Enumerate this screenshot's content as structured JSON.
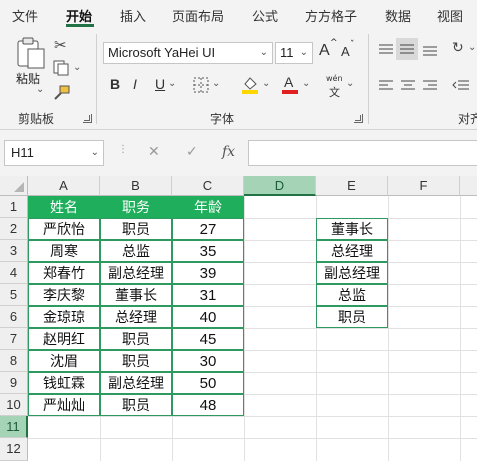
{
  "tabs": [
    "文件",
    "开始",
    "插入",
    "页面布局",
    "公式",
    "方方格子",
    "数据",
    "视图"
  ],
  "active_tab": "开始",
  "ribbon": {
    "clipboard": {
      "paste_label": "粘贴",
      "group_label": "剪贴板"
    },
    "font": {
      "font_name": "Microsoft YaHei UI",
      "font_size": "11",
      "bold": "B",
      "italic": "I",
      "underline": "U",
      "grow": "A",
      "shrink": "A",
      "wen": "wén",
      "wen_char": "文",
      "group_label": "字体",
      "fill_color": "#ffd700",
      "font_color": "#e02020"
    },
    "align": {
      "group_label": "对齐"
    }
  },
  "formula_bar": {
    "name_box": "H11",
    "cancel": "✕",
    "enter": "✓",
    "fx": "fx",
    "formula": ""
  },
  "columns": [
    "A",
    "B",
    "C",
    "D",
    "E",
    "F"
  ],
  "selected_column": "D",
  "rows": [
    "1",
    "2",
    "3",
    "4",
    "5",
    "6",
    "7",
    "8",
    "9",
    "10",
    "11",
    "12"
  ],
  "selected_row": "11",
  "table": {
    "headers": [
      "姓名",
      "职务",
      "年龄"
    ],
    "rows": [
      [
        "严欣怡",
        "职员",
        "27"
      ],
      [
        "周寒",
        "总监",
        "35"
      ],
      [
        "郑春竹",
        "副总经理",
        "39"
      ],
      [
        "李庆黎",
        "董事长",
        "31"
      ],
      [
        "金琼琼",
        "总经理",
        "40"
      ],
      [
        "赵明红",
        "职员",
        "45"
      ],
      [
        "沈眉",
        "职员",
        "30"
      ],
      [
        "钱虹霖",
        "副总经理",
        "50"
      ],
      [
        "严灿灿",
        "职员",
        "48"
      ]
    ]
  },
  "rank_list": [
    "董事长",
    "总经理",
    "副总经理",
    "总监",
    "职员"
  ],
  "colors": {
    "accent": "#217346",
    "header_fill": "#1fae5b",
    "cell_border": "#2f9a5f"
  }
}
